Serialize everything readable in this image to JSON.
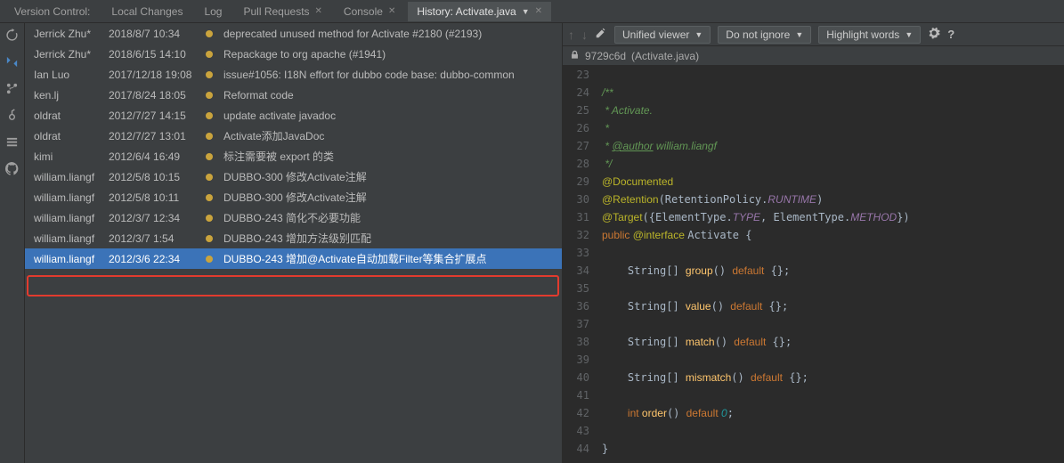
{
  "tabs": [
    "Version Control:",
    "Local Changes",
    "Log",
    "Pull Requests",
    "Console",
    "History: Activate.java"
  ],
  "commits": [
    {
      "author": "Jerrick Zhu*",
      "date": "2018/8/7 10:34",
      "msg": "deprecated unused method for Activate #2180 (#2193)"
    },
    {
      "author": "Jerrick Zhu*",
      "date": "2018/6/15 14:10",
      "msg": "Repackage to org apache (#1941)"
    },
    {
      "author": "Ian Luo",
      "date": "2017/12/18 19:08",
      "msg": "issue#1056: I18N effort for dubbo code base: dubbo-common"
    },
    {
      "author": "ken.lj",
      "date": "2017/8/24 18:05",
      "msg": "Reformat code"
    },
    {
      "author": "oldrat",
      "date": "2012/7/27 14:15",
      "msg": "update activate javadoc"
    },
    {
      "author": "oldrat",
      "date": "2012/7/27 13:01",
      "msg": "Activate添加JavaDoc"
    },
    {
      "author": "kimi",
      "date": "2012/6/4 16:49",
      "msg": "标注需要被 export 的类"
    },
    {
      "author": "william.liangf",
      "date": "2012/5/8 10:15",
      "msg": "DUBBO-300 修改Activate注解"
    },
    {
      "author": "william.liangf",
      "date": "2012/5/8 10:11",
      "msg": "DUBBO-300 修改Activate注解"
    },
    {
      "author": "william.liangf",
      "date": "2012/3/7 12:34",
      "msg": "DUBBO-243 简化不必要功能"
    },
    {
      "author": "william.liangf",
      "date": "2012/3/7 1:54",
      "msg": "DUBBO-243 增加方法级别匹配"
    },
    {
      "author": "william.liangf",
      "date": "2012/3/6 22:34",
      "msg": "DUBBO-243 增加@Activate自动加载Filter等集合扩展点",
      "selected": true
    }
  ],
  "toolbar": {
    "viewer": "Unified viewer",
    "ignore": "Do not ignore",
    "highlight": "Highlight words"
  },
  "crumb": {
    "hash": "9729c6d",
    "file": "(Activate.java)"
  },
  "code": {
    "start": 23,
    "lines": [
      "",
      "<span class='k-comment'>/**</span>",
      "<span class='k-comment'> * Activate.</span>",
      "<span class='k-comment'> *</span>",
      "<span class='k-comment'> * <span class='k-author'>@author</span> william.liangf</span>",
      "<span class='k-comment'> */</span>",
      "<span class='k-anno'>@Documented</span>",
      "<span class='k-anno'>@Retention</span>(RetentionPolicy.<span class='k-const'>RUNTIME</span>)",
      "<span class='k-anno'>@Target</span>({ElementType.<span class='k-const'>TYPE</span>, ElementType.<span class='k-const'>METHOD</span>})",
      "<span class='k-kw'>public </span><span class='k-anno'>@interface </span>Activate {",
      "",
      "    String[] <span class='k-method'>group</span>() <span class='k-kw'>default</span> {};",
      "",
      "    String[] <span class='k-method'>value</span>() <span class='k-kw'>default</span> {};",
      "",
      "    String[] <span class='k-method'>match</span>() <span class='k-kw'>default</span> {};",
      "",
      "    String[] <span class='k-method'>mismatch</span>() <span class='k-kw'>default</span> {};",
      "",
      "    <span class='k-kw'>int </span><span class='k-method'>order</span>() <span class='k-kw'>default </span><span class='k-type'>0</span>;",
      "",
      "}"
    ]
  }
}
